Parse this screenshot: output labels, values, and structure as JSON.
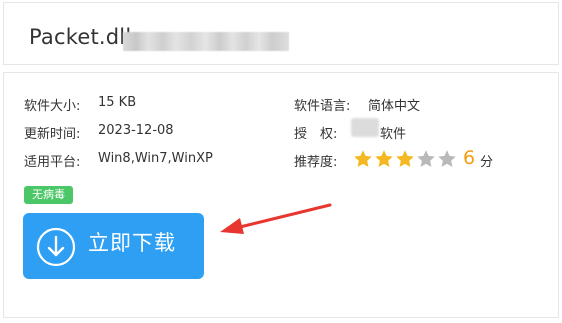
{
  "title": "Packet.dll",
  "info": {
    "size_label": "软件大小:",
    "size_value": "15 KB",
    "update_label": "更新时间:",
    "update_value": "2023-12-08",
    "platform_label": "适用平台:",
    "platform_value": "Win8,Win7,WinXP",
    "language_label": "软件语言:",
    "language_value": "简体中文",
    "license_label": "授　权:",
    "license_value": "软件",
    "rating_label": "推荐度:",
    "rating_stars_filled": 3,
    "rating_stars_total": 5,
    "rating_score": "6",
    "rating_unit": "分"
  },
  "badge": "无病毒",
  "download_button": {
    "label": "立即下载",
    "icon": "download-arrow-icon"
  },
  "colors": {
    "button_blue": "#2e9ff3",
    "badge_green": "#4cc767",
    "star_gold": "#f5b820",
    "star_gray": "#b9b9b9",
    "score_orange": "#f39c12",
    "arrow_red": "#e8352f"
  }
}
